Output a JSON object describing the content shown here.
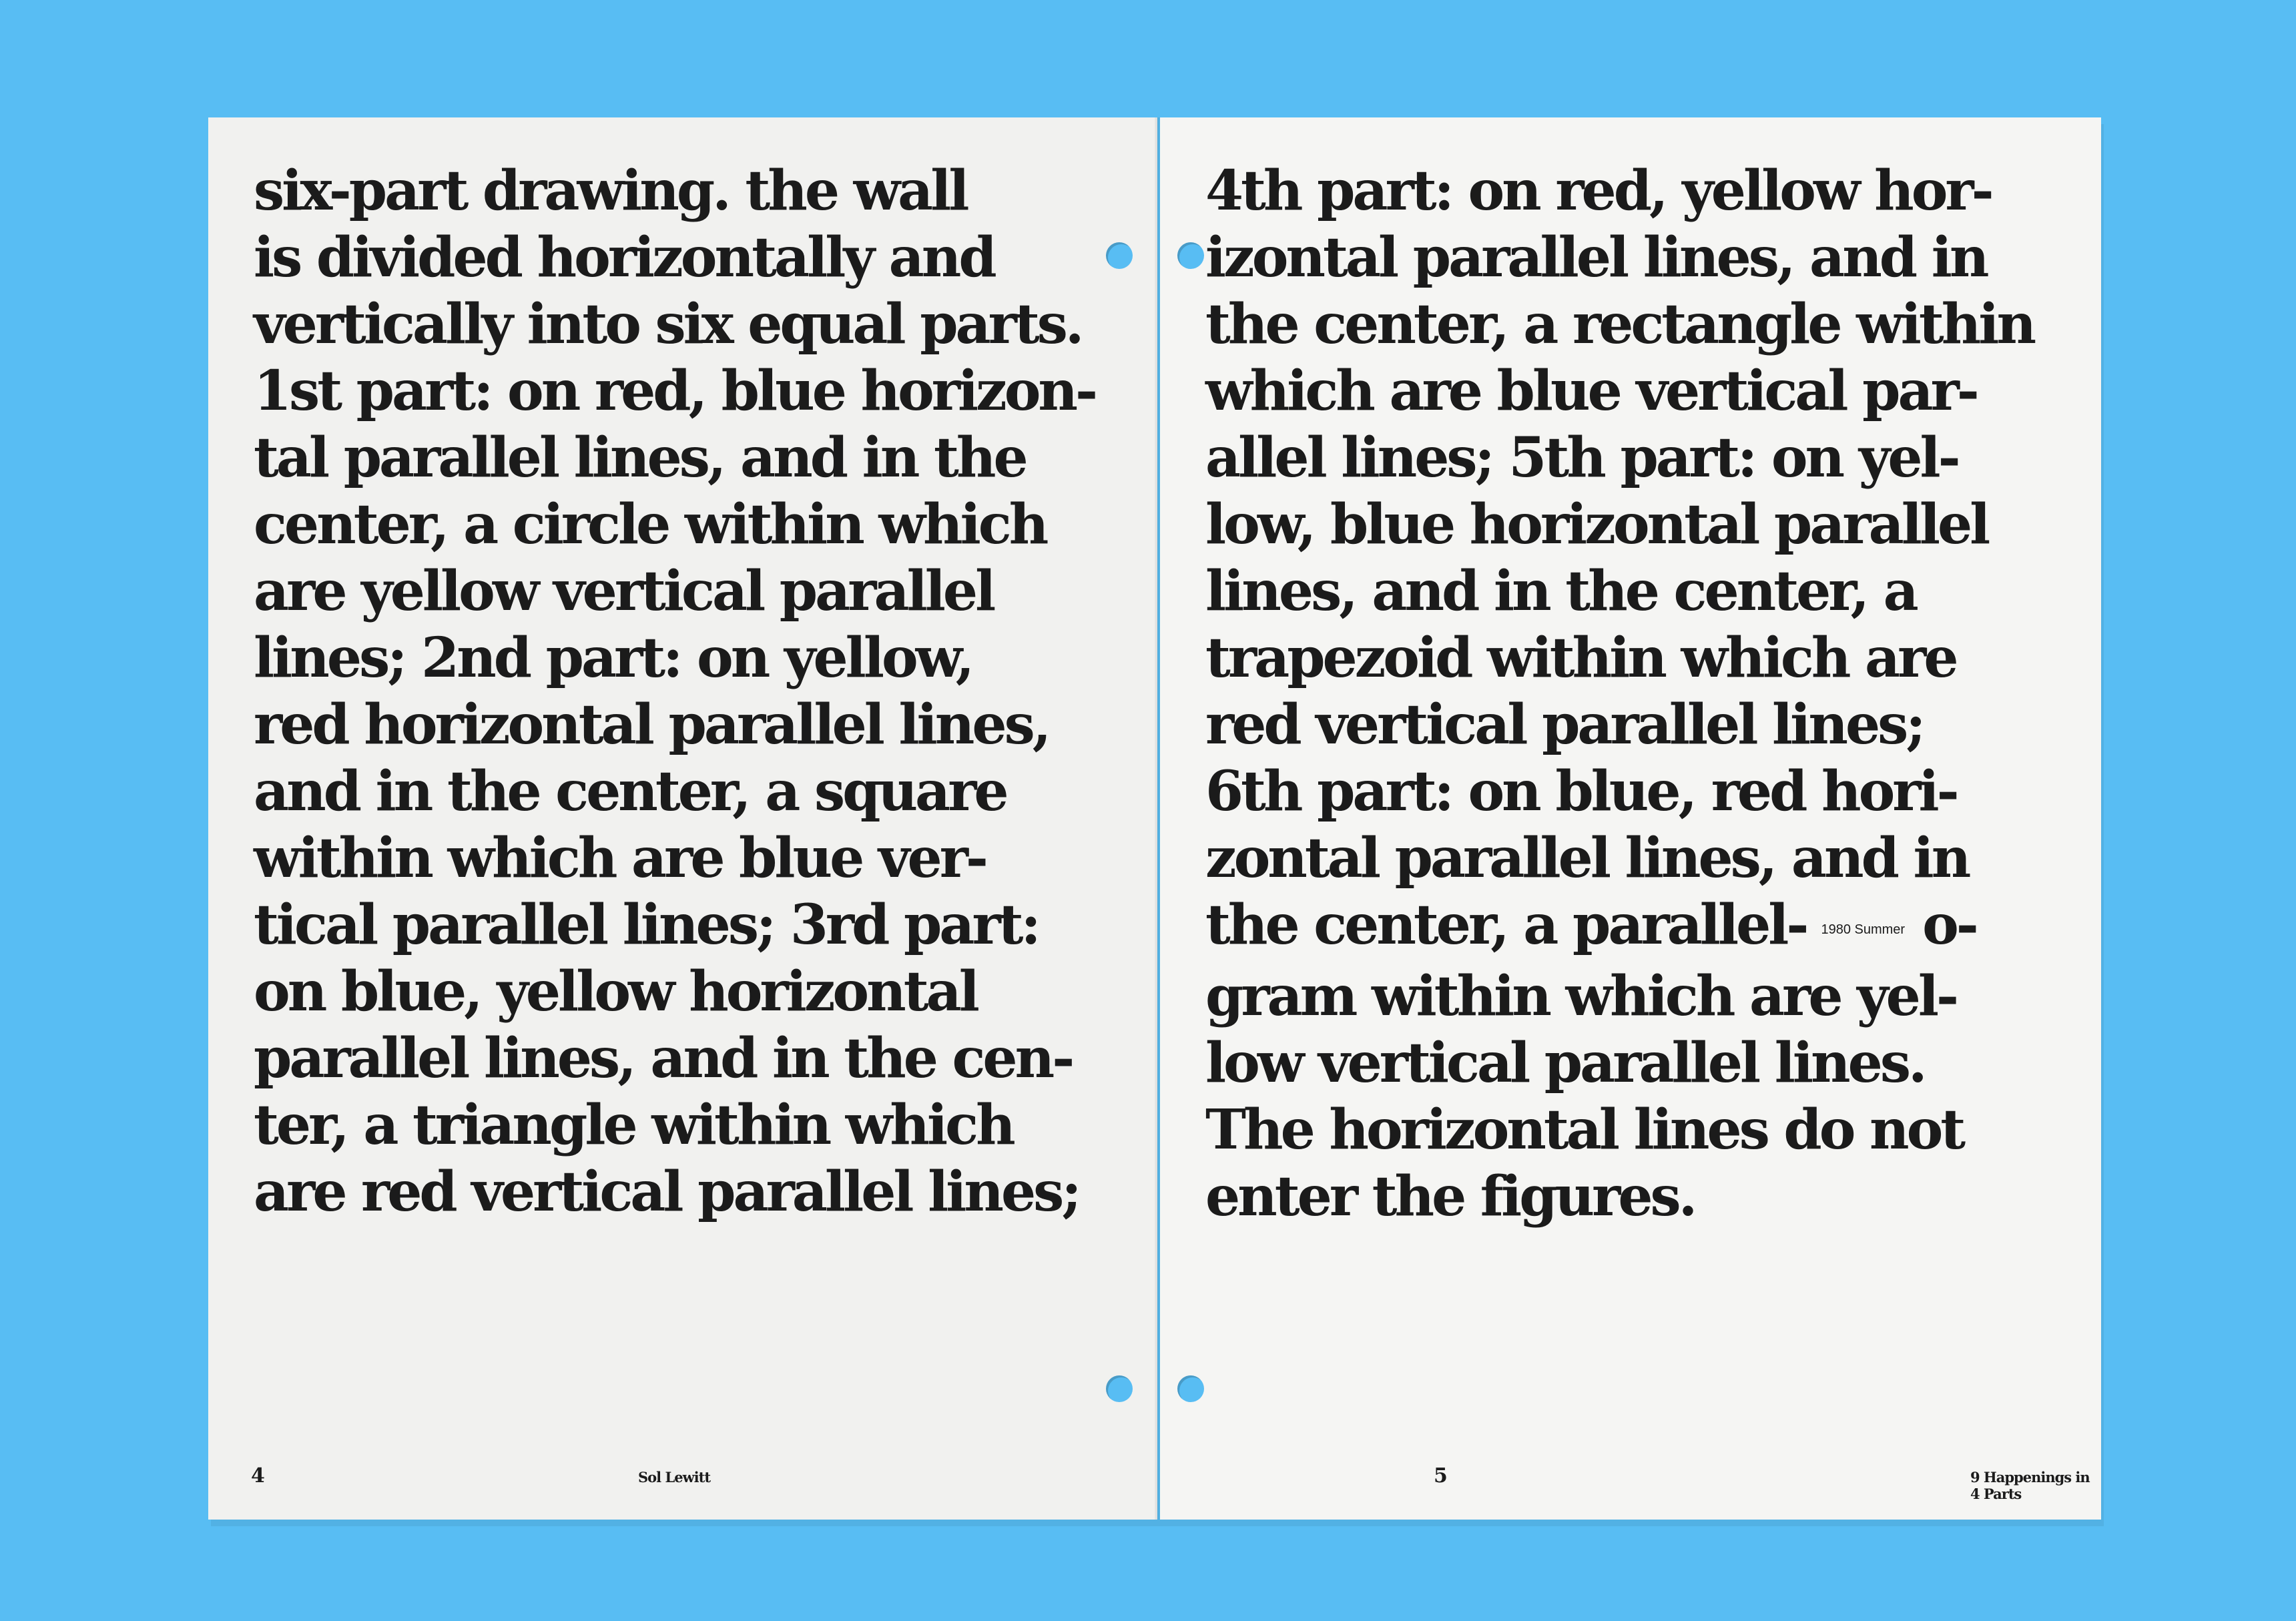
{
  "left_page": {
    "lines": [
      "six-part drawing. the wall",
      "is divided horizontally and",
      "vertically into six equal parts.",
      "1st part: on red, blue horizon-",
      "tal parallel lines, and in the",
      "center, a circle within which",
      "are yellow vertical parallel",
      "lines; 2nd part: on yellow,",
      "red horizontal parallel lines,",
      "and in the center, a square",
      "within which are blue ver-",
      "tical parallel lines; 3rd part:",
      "on blue, yellow horizontal",
      "parallel lines, and in the cen-",
      "ter, a triangle within which",
      "are red vertical parallel lines;"
    ],
    "page_number": "4",
    "running_title": "Sol Lewitt"
  },
  "right_page": {
    "lines": [
      "4th part: on red, yellow hor-",
      "izontal parallel lines, and in",
      "the center, a rectangle within",
      "which are blue vertical par-",
      "allel lines; 5th part: on yel-",
      "low, blue horizontal parallel",
      "lines, and in the center, a",
      "trapezoid within which are",
      "red vertical parallel lines;",
      "6th part: on blue, red hori-",
      "zontal parallel lines, and in"
    ],
    "line_12_before": "the center, a parallel-",
    "inline_note": "1980 Summer",
    "line_12_after": "o-",
    "lines_end": [
      "gram within which are yel-",
      "low vertical parallel lines.",
      "The horizontal lines do not",
      "enter the figures."
    ],
    "page_number": "5",
    "running_title": "9 Happenings in 4 Parts"
  }
}
